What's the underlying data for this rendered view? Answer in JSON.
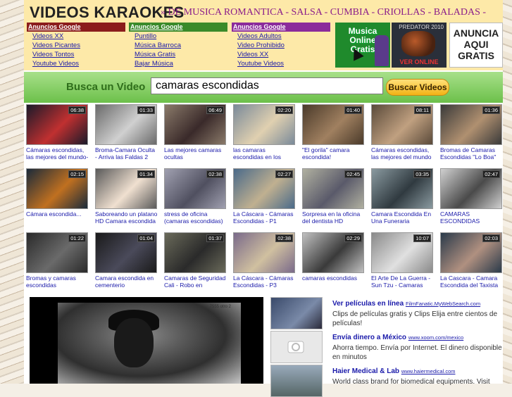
{
  "site": {
    "title": "VIDEOS KARAOKES",
    "tagline": "» DE MUSICA ROMANTICA - SALSA - CUMBIA - CRIOLLAS - BALADAS -"
  },
  "ad_columns": [
    {
      "header": "Anuncios Google",
      "color": "#8b1c1c",
      "links": [
        "Videos XX",
        "Videos Picantes",
        "Videos Tontos",
        "Youtube Videos"
      ]
    },
    {
      "header": "Anuncios Google",
      "color": "#3a8a2a",
      "links": [
        "Puntillo",
        "Música Barroca",
        "Música Gratis",
        "Bajar Música"
      ]
    },
    {
      "header": "Anuncios Google",
      "color": "#8b2b9b",
      "links": [
        "Videos Adultos",
        "Video Prohibido",
        "Videos XX",
        "Youtube Videos"
      ]
    }
  ],
  "promos": {
    "musica": "Musica Online Gratis",
    "predator_top": "PREDATOR 2010",
    "predator_bottom": "VER ONLINE",
    "anuncia": "ANUNCIA AQUI GRATIS"
  },
  "search": {
    "label": "Busca un Video",
    "value": "camaras escondidas",
    "button": "Buscar Videos"
  },
  "videos": [
    {
      "duration": "06:38",
      "title": "Cámaras escondidas, las mejores del mundo-"
    },
    {
      "duration": "01:33",
      "title": "Broma-Camara Oculta - Arriva las Faldas 2"
    },
    {
      "duration": "06:49",
      "title": "Las mejores camaras ocultas"
    },
    {
      "duration": "02:20",
      "title": "las camaras escondidas en los"
    },
    {
      "duration": "01:40",
      "title": "\"El gorila\" camara escondida!"
    },
    {
      "duration": "08:11",
      "title": "Cámaras escondidas, las mejores del mundo"
    },
    {
      "duration": "01:36",
      "title": "Bromas de Camaras Escondidas \"Lo Boa\""
    },
    {
      "duration": "02:15",
      "title": "Cámara escondida..."
    },
    {
      "duration": "01:34",
      "title": "Saboreando un platano HD Camara escondida"
    },
    {
      "duration": "02:38",
      "title": "stress de oficina (camaras escondidas)"
    },
    {
      "duration": "02:27",
      "title": "La Cáscara - Cámaras Escondidas - P1"
    },
    {
      "duration": "02:45",
      "title": "Sorpresa en la oficina del dentista HD Camara"
    },
    {
      "duration": "03:35",
      "title": "Camara Escondida En Una Funeraria"
    },
    {
      "duration": "02:47",
      "title": "CAMARAS ESCONDIDAS CHINAS"
    },
    {
      "duration": "01:22",
      "title": "Bromas y camaras escondidas"
    },
    {
      "duration": "01:04",
      "title": "Camara escondida en cementerio"
    },
    {
      "duration": "01:37",
      "title": "Camaras de Seguridad Cali - Robo en"
    },
    {
      "duration": "02:38",
      "title": "La Cáscara - Cámaras Escondidas - P3"
    },
    {
      "duration": "02:29",
      "title": "camaras escondidas"
    },
    {
      "duration": "10:07",
      "title": "El Arte De La Guerra - Sun Tzu - Camaras"
    },
    {
      "duration": "02:03",
      "title": "La Cascara - Camara Escondida del Taxista"
    }
  ],
  "player": {
    "label": "7555 otro 2"
  },
  "text_ads": [
    {
      "title": "Ver películas en línea",
      "url": "FilmFanatic.MyWebSearch.com",
      "desc": "Clips de películas gratis y Clips Elija entre cientos de películas!"
    },
    {
      "title": "Envía dinero a México",
      "url": "www.xoom.com/mexico",
      "desc": "Ahorra tiempo. Envía por Internet. El dinero disponible en minutos"
    },
    {
      "title": "Haier Medical & Lab",
      "url": "www.haiermedical.com",
      "desc": "World class brand for biomedical equipments. Visit"
    }
  ]
}
